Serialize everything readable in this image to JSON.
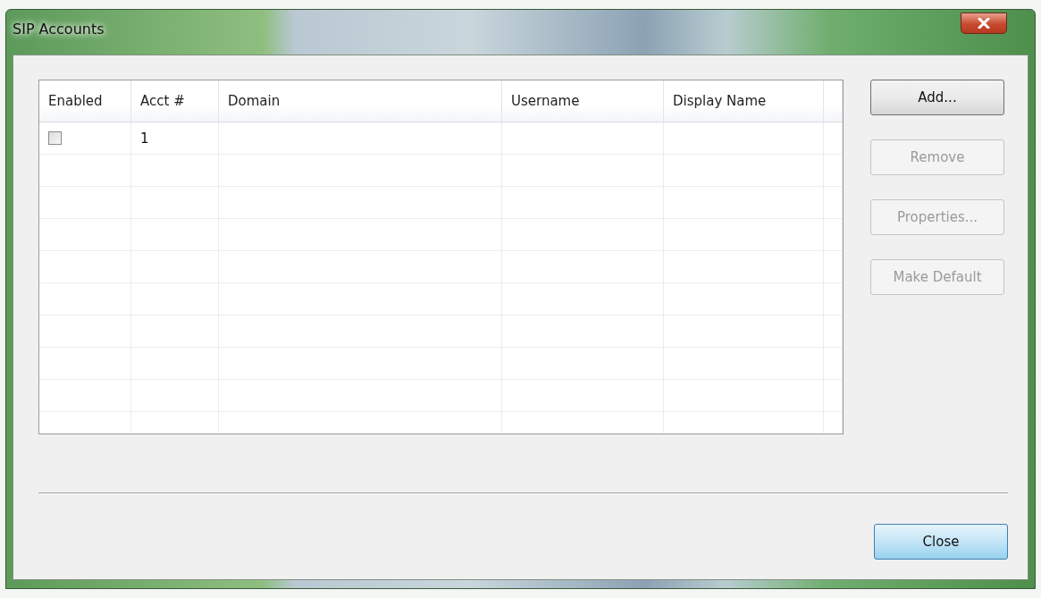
{
  "window": {
    "title": "SIP Accounts"
  },
  "table": {
    "columns": [
      "Enabled",
      "Acct #",
      "Domain",
      "Username",
      "Display Name"
    ],
    "rows": [
      {
        "enabled": false,
        "acct": "1"
      }
    ]
  },
  "side_buttons": [
    {
      "label": "Add...",
      "disabled": false
    },
    {
      "label": "Remove",
      "disabled": true
    },
    {
      "label": "Properties...",
      "disabled": true
    },
    {
      "label": "Make Default",
      "disabled": true
    }
  ],
  "footer_buttons": [
    {
      "label": "Close",
      "disabled": false
    }
  ]
}
